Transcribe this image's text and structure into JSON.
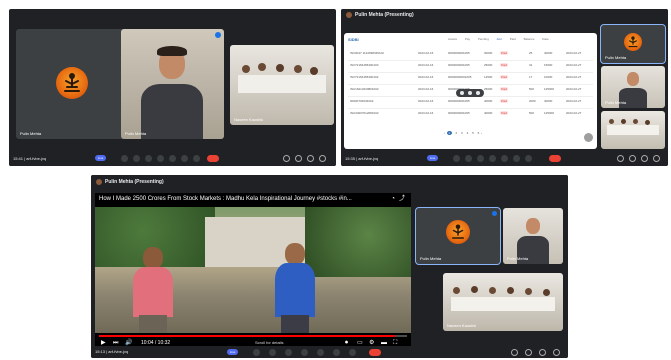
{
  "panel_a": {
    "tiles": [
      {
        "name": "Pulin Mehta"
      },
      {
        "name": "Pulin Mehta"
      },
      {
        "name": "Naveen Kaushik"
      }
    ],
    "time": "15:41 | arf-fvbe-jvq"
  },
  "panel_b": {
    "recording_title": "Pulin Mehta (Presenting)",
    "sheet": {
      "brand": "SIDBI",
      "columns": [
        "Assets",
        "Pay",
        "Pending",
        "Amt",
        "Paid",
        "Balance",
        "Date"
      ],
      "rows": [
        [
          "INV0047 1134698345102",
          "2023-02-15",
          "0000000001005",
          "30000",
          "25",
          "40000",
          "2023-02-27"
        ],
        [
          "INV72154465300100",
          "2023-02-16",
          "0000000001005",
          "25000",
          "31",
          "15000",
          "2023-02-27"
        ],
        [
          "INV72154465300102",
          "2023-02-16",
          "00000000001005",
          "12500",
          "17",
          "10000",
          "2023-02-27"
        ],
        [
          "INU16213230801002",
          "2023-02-16",
          "0000000001005",
          "25000",
          "500",
          "125000",
          "2023-02-27"
        ],
        [
          "00600702034002",
          "2023-02-16",
          "0000000001005",
          "40000",
          "2000",
          "40000",
          "2023-02-27"
        ],
        [
          "INU34007012081002",
          "2023-02-16",
          "0000000001005",
          "40000",
          "500",
          "125000",
          "2023-02-27"
        ]
      ],
      "status_badge": "Paid",
      "pager": [
        "1",
        "2",
        "3",
        "4",
        "5",
        "6"
      ]
    },
    "side_tiles": [
      {
        "name": "Pulin Mehta"
      },
      {
        "name": "Pulin Mehta"
      },
      {
        "name": ""
      }
    ],
    "time": "15:35 | arf-fvbe-jvq"
  },
  "panel_c": {
    "recording_title": "Pulin Mehta (Presenting)",
    "video": {
      "title": "How I Made 2500 Crores From Stock Markets : Madhu Kela Inspirational Journey #stocks #in...",
      "time": "10:04 / 10:32",
      "scroll_hint": "Scroll for details",
      "progress": 0.96
    },
    "side_tiles": [
      {
        "name": "Pulin Mehta"
      },
      {
        "name": "Pulin Mehta"
      },
      {
        "name": "Naveen Kaushik"
      }
    ],
    "time": "15:13 | arf-fvbe-jvq",
    "live_label": "Live"
  },
  "live_label": "Live"
}
